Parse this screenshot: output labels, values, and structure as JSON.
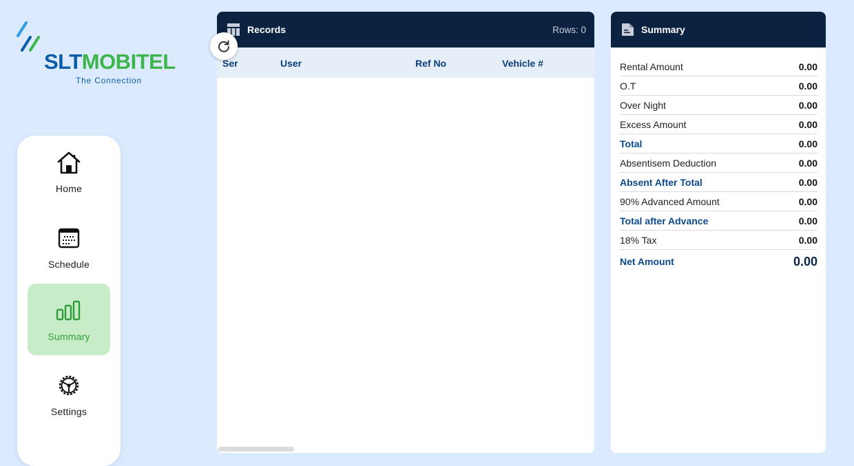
{
  "brand": {
    "wordmark_left": "SLT",
    "wordmark_right": "MOBITEL",
    "tagline": "The Connection",
    "colors": {
      "blue": "#0a5ea8",
      "green": "#3db54a"
    }
  },
  "sidebar": {
    "items": [
      {
        "label": "Home",
        "icon": "home-icon",
        "active": false
      },
      {
        "label": "Schedule",
        "icon": "calendar-icon",
        "active": false
      },
      {
        "label": "Summary",
        "icon": "bar-chart-icon",
        "active": true
      },
      {
        "label": "Settings",
        "icon": "gear-icon",
        "active": false
      }
    ]
  },
  "records": {
    "title": "Records",
    "icon": "table-icon",
    "rows_text": "Rows: 0",
    "refresh_icon": "refresh-icon",
    "columns": [
      "Ser",
      "User",
      "Ref No",
      "Vehicle #"
    ]
  },
  "summary": {
    "title": "Summary",
    "icon": "document-icon",
    "rows": [
      {
        "label": "Rental Amount",
        "value": "0.00",
        "highlight": false
      },
      {
        "label": "O.T",
        "value": "0.00",
        "highlight": false
      },
      {
        "label": "Over Night",
        "value": "0.00",
        "highlight": false
      },
      {
        "label": "Excess Amount",
        "value": "0.00",
        "highlight": false
      },
      {
        "label": "Total",
        "value": "0.00",
        "highlight": true
      },
      {
        "label": "Absentisem Deduction",
        "value": "0.00",
        "highlight": false
      },
      {
        "label": "Absent After Total",
        "value": "0.00",
        "highlight": true
      },
      {
        "label": "90% Advanced Amount",
        "value": "0.00",
        "highlight": false
      },
      {
        "label": "Total after Advance",
        "value": "0.00",
        "highlight": true
      },
      {
        "label": "18% Tax",
        "value": "0.00",
        "highlight": false
      }
    ],
    "net": {
      "label": "Net Amount",
      "value": "0.00"
    }
  },
  "colors": {
    "page_bg": "#dbeafe",
    "header_bg": "#0b2240",
    "active_nav_bg": "#c9ecc8",
    "active_nav_text": "#2e9e3a",
    "label_highlight": "#0a4a8c"
  }
}
